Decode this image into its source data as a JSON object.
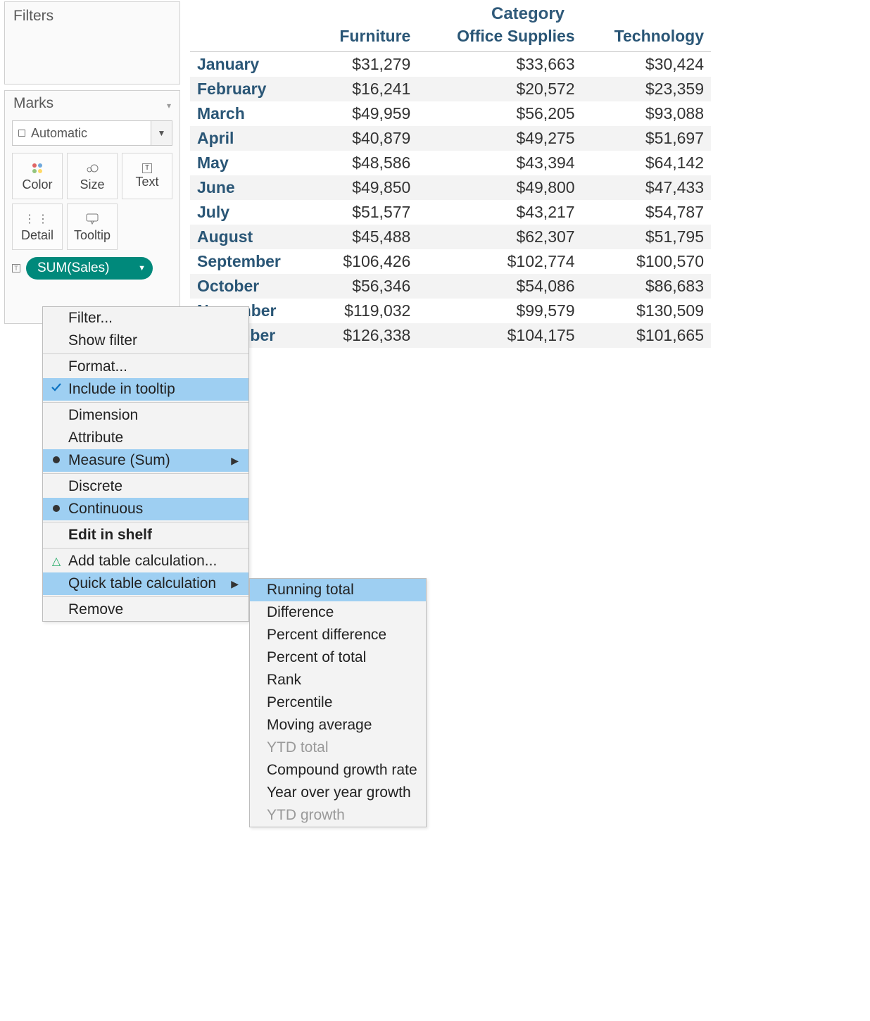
{
  "filters": {
    "title": "Filters"
  },
  "marks": {
    "title": "Marks",
    "mark_type": "Automatic",
    "buttons": {
      "color": "Color",
      "size": "Size",
      "text": "Text",
      "detail": "Detail",
      "tooltip": "Tooltip"
    },
    "pill": "SUM(Sales)"
  },
  "context_menu": {
    "filter": "Filter...",
    "show_filter": "Show filter",
    "format": "Format...",
    "include_in_tooltip": "Include in tooltip",
    "dimension": "Dimension",
    "attribute": "Attribute",
    "measure_sum": "Measure (Sum)",
    "discrete": "Discrete",
    "continuous": "Continuous",
    "edit_in_shelf": "Edit in shelf",
    "add_table_calc": "Add table calculation...",
    "quick_table_calc": "Quick table calculation",
    "remove": "Remove"
  },
  "quick_calc_submenu": {
    "running_total": "Running total",
    "difference": "Difference",
    "percent_difference": "Percent difference",
    "percent_of_total": "Percent of total",
    "rank": "Rank",
    "percentile": "Percentile",
    "moving_average": "Moving average",
    "ytd_total": "YTD total",
    "compound_growth_rate": "Compound growth rate",
    "year_over_year_growth": "Year over year growth",
    "ytd_growth": "YTD growth"
  },
  "crosstab": {
    "super_header": "Category",
    "columns": [
      "Furniture",
      "Office Supplies",
      "Technology"
    ],
    "rows": [
      {
        "label": "January",
        "values": [
          "$31,279",
          "$33,663",
          "$30,424"
        ]
      },
      {
        "label": "February",
        "values": [
          "$16,241",
          "$20,572",
          "$23,359"
        ]
      },
      {
        "label": "March",
        "values": [
          "$49,959",
          "$56,205",
          "$93,088"
        ]
      },
      {
        "label": "April",
        "values": [
          "$40,879",
          "$49,275",
          "$51,697"
        ]
      },
      {
        "label": "May",
        "values": [
          "$48,586",
          "$43,394",
          "$64,142"
        ]
      },
      {
        "label": "June",
        "values": [
          "$49,850",
          "$49,800",
          "$47,433"
        ]
      },
      {
        "label": "July",
        "values": [
          "$51,577",
          "$43,217",
          "$54,787"
        ]
      },
      {
        "label": "August",
        "values": [
          "$45,488",
          "$62,307",
          "$51,795"
        ]
      },
      {
        "label": "September",
        "values": [
          "$106,426",
          "$102,774",
          "$100,570"
        ]
      },
      {
        "label": "October",
        "values": [
          "$56,346",
          "$54,086",
          "$86,683"
        ]
      },
      {
        "label": "November",
        "values": [
          "$119,032",
          "$99,579",
          "$130,509"
        ]
      },
      {
        "label": "December",
        "values": [
          "$126,338",
          "$104,175",
          "$101,665"
        ]
      }
    ]
  }
}
